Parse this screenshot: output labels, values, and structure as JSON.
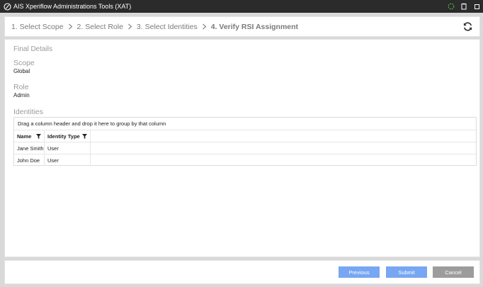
{
  "window": {
    "title": "AIS Xperiflow Administrations Tools (XAT)",
    "app_icon": "circle-slash-icon",
    "controls": [
      "palette-icon",
      "clipboard-icon",
      "maximize-icon"
    ]
  },
  "wizard": {
    "steps": [
      {
        "label": "1. Select Scope",
        "current": false
      },
      {
        "label": "2. Select Role",
        "current": false
      },
      {
        "label": "3. Select Identities",
        "current": false
      },
      {
        "label": "4. Verify RSI Assignment",
        "current": true
      }
    ],
    "refresh_icon": "refresh-icon"
  },
  "details": {
    "section_title": "Final Details",
    "scope_label": "Scope",
    "scope_value": "Global",
    "role_label": "Role",
    "role_value": "Admin",
    "identities_label": "Identities"
  },
  "grid": {
    "group_hint": "Drag a column header and drop it here to group by that column",
    "columns": [
      "Name",
      "Identity Type"
    ],
    "rows": [
      [
        "Jane Smith",
        "User"
      ],
      [
        "John Doe",
        "User"
      ]
    ]
  },
  "footer": {
    "previous_label": "Previous",
    "submit_label": "Submit",
    "cancel_label": "Cancel"
  },
  "colors": {
    "primary_button": "#78a6f2",
    "cancel_button": "#9c9c9c",
    "titlebar": "#2b2b2b"
  }
}
